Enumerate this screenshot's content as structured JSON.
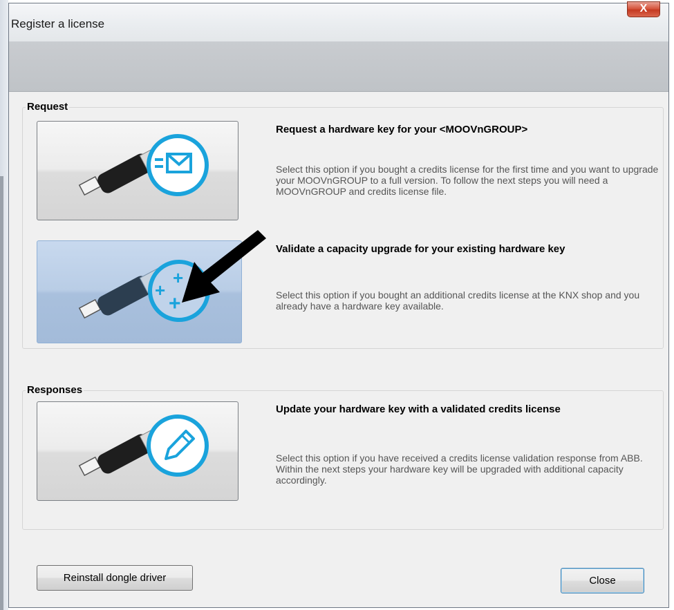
{
  "window": {
    "title": "Register a license",
    "close_glyph": "X"
  },
  "sections": {
    "request": {
      "label": "Request"
    },
    "responses": {
      "label": "Responses"
    }
  },
  "options": [
    {
      "title": "Request a hardware key for your <MOOVnGROUP>",
      "description": "Select this option if you bought a credits license for the first time and you want to upgrade your MOOVnGROUP to a full version. To follow the next steps you will need a MOOVnGROUP and credits license file.",
      "icon": "usb-mail-icon"
    },
    {
      "title": "Validate a capacity upgrade for your existing hardware key",
      "description": "Select this option if you bought an additional credits license at the KNX shop and you already have a hardware key available.",
      "icon": "usb-plus-icon"
    },
    {
      "title": "Update your hardware key with a validated credits license",
      "description": "Select this option if you have received a credits license validation response from ABB. Within the next steps your hardware key will be upgraded with additional capacity accordingly.",
      "icon": "usb-pencil-icon"
    }
  ],
  "footer": {
    "reinstall_label": "Reinstall dongle driver",
    "close_label": "Close"
  },
  "colors": {
    "accent_cyan": "#1aa3dc",
    "active_button": "#b3c8e3"
  }
}
